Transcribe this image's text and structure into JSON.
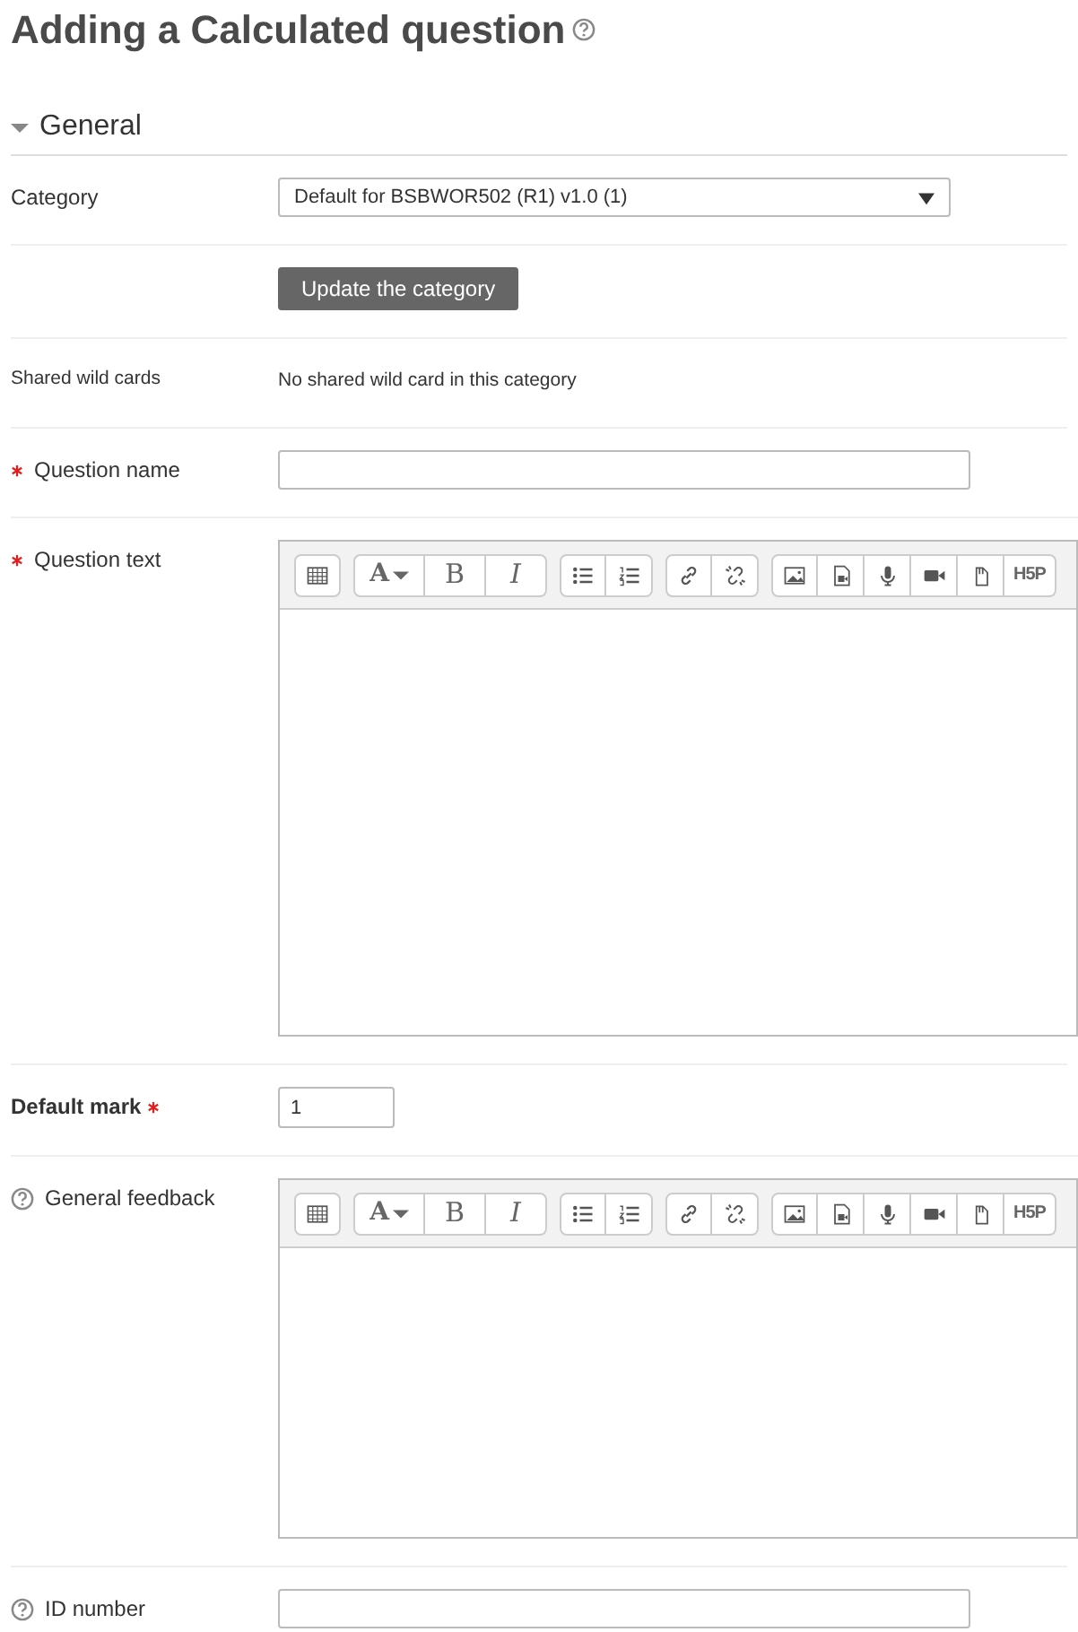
{
  "title": "Adding a Calculated question",
  "title_help": true,
  "section": {
    "label": "General",
    "expanded": true
  },
  "rows": [
    {
      "kind": "select",
      "label": "Category",
      "value": "Default for BSBWOR502 (R1) v1.0 (1)"
    },
    {
      "kind": "button",
      "label": "Update the category"
    },
    {
      "kind": "static",
      "label": "Shared wild cards",
      "value": "No shared wild card in this category"
    },
    {
      "kind": "text",
      "label": "Question name",
      "required": true
    },
    {
      "kind": "editor",
      "label": "Question text",
      "required": true,
      "toolbar": [
        [
          {
            "kind": "icon"
          }
        ],
        [
          {
            "kind": "dropdown",
            "label": "A"
          },
          {
            "kind": "bold",
            "label": "B"
          },
          {
            "kind": "italic",
            "label": "I"
          }
        ],
        [
          {
            "kind": "icon"
          },
          {
            "kind": "icon"
          }
        ],
        [
          {
            "kind": "icon"
          },
          {
            "kind": "icon"
          }
        ],
        [
          {
            "kind": "icon"
          },
          {
            "kind": "icon"
          },
          {
            "kind": "icon"
          },
          {
            "kind": "icon"
          },
          {
            "kind": "icon"
          },
          {
            "kind": "logo",
            "label": "H5P"
          }
        ]
      ]
    },
    {
      "kind": "number",
      "label": "Default mark",
      "required": true,
      "bold": true,
      "value": "1"
    },
    {
      "kind": "editor",
      "label": "General feedback",
      "help": true,
      "toolbar": [
        [
          {
            "kind": "icon"
          }
        ],
        [
          {
            "kind": "dropdown",
            "label": "A"
          },
          {
            "kind": "bold",
            "label": "B"
          },
          {
            "kind": "italic",
            "label": "I"
          }
        ],
        [
          {
            "kind": "icon"
          },
          {
            "kind": "icon"
          }
        ],
        [
          {
            "kind": "icon"
          },
          {
            "kind": "icon"
          }
        ],
        [
          {
            "kind": "icon"
          },
          {
            "kind": "icon"
          },
          {
            "kind": "icon"
          },
          {
            "kind": "icon"
          },
          {
            "kind": "icon"
          },
          {
            "kind": "logo",
            "label": "H5P"
          }
        ]
      ]
    },
    {
      "kind": "text",
      "label": "ID number",
      "help": true
    }
  ]
}
